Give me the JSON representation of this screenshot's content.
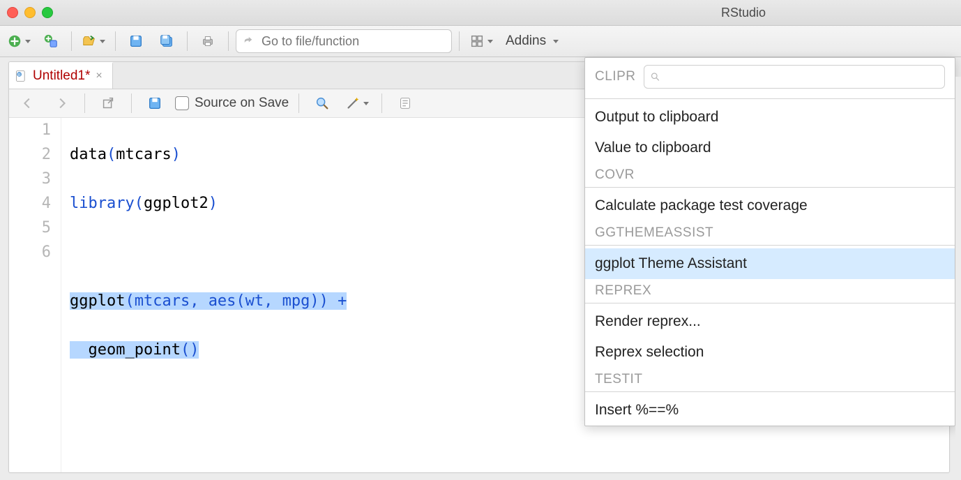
{
  "window": {
    "title": "RStudio"
  },
  "main_toolbar": {
    "goto_placeholder": "Go to file/function",
    "addins_label": "Addins"
  },
  "tab": {
    "label": "Untitled1*"
  },
  "editor_toolbar": {
    "source_on_save_label": "Source on Save"
  },
  "code": {
    "lines": [
      {
        "n": "1"
      },
      {
        "n": "2"
      },
      {
        "n": "3"
      },
      {
        "n": "4"
      },
      {
        "n": "5"
      },
      {
        "n": "6"
      }
    ],
    "l1_fun": "data",
    "l1_arg": "mtcars",
    "l2_key": "library",
    "l2_arg": "ggplot2",
    "l4_pref": "ggplot",
    "l4_rest": "(mtcars, aes(wt, mpg)) +",
    "l5_pref": "  geom_point",
    "l5_rest": "()"
  },
  "addins_menu": {
    "search_placeholder": "",
    "sections": {
      "clipr": "CLIPR",
      "covr": "COVR",
      "ggtheme": "GGTHEMEASSIST",
      "reprex": "REPREX",
      "testit": "TESTIT"
    },
    "items": {
      "clipr1": "Output to clipboard",
      "clipr2": "Value to clipboard",
      "covr1": "Calculate package test coverage",
      "gg1": "ggplot Theme Assistant",
      "rep1": "Render reprex...",
      "rep2": "Reprex selection",
      "test1": "Insert %==%"
    }
  }
}
